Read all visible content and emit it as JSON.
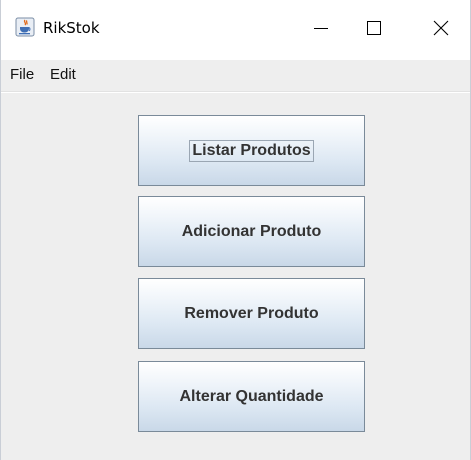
{
  "window": {
    "title": "RikStok",
    "app_icon": "java-cup-icon",
    "controls": {
      "minimize": "minimize-icon",
      "maximize": "maximize-icon",
      "close": "close-icon"
    }
  },
  "menubar": {
    "items": [
      {
        "label": "File"
      },
      {
        "label": "Edit"
      }
    ]
  },
  "main": {
    "buttons": [
      {
        "label": "Listar Produtos",
        "focused": true
      },
      {
        "label": "Adicionar Produto",
        "focused": false
      },
      {
        "label": "Remover Produto",
        "focused": false
      },
      {
        "label": "Alterar Quantidade",
        "focused": false
      }
    ]
  },
  "colors": {
    "content_background": "#eeeeee",
    "button_border": "#7a8a99",
    "button_text": "#333333"
  }
}
